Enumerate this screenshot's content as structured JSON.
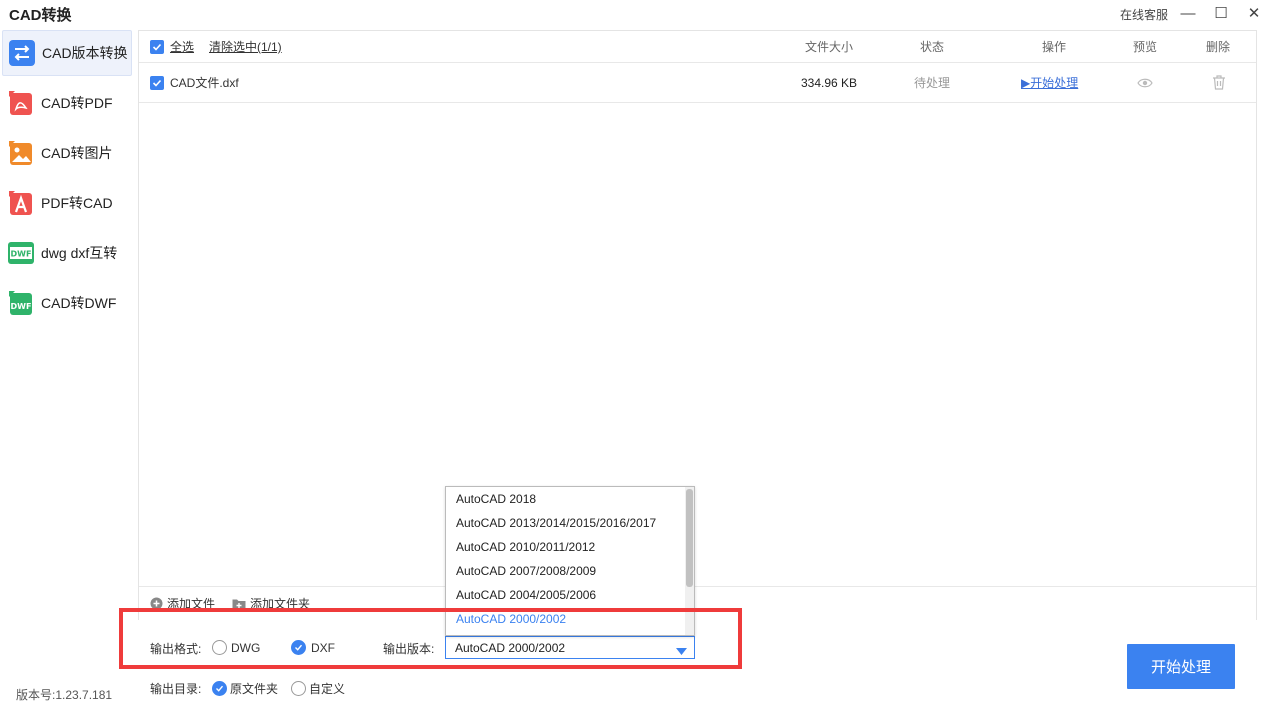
{
  "app": {
    "title": "CAD转换",
    "online_service": "在线客服",
    "version": "版本号:1.23.7.181"
  },
  "window_controls": {
    "minimize_glyph": "—",
    "maximize_glyph": "☐",
    "close_glyph": "✕"
  },
  "sidebar": {
    "items": [
      {
        "label": "CAD版本转换",
        "icon": "convert-arrows-icon",
        "active": true
      },
      {
        "label": "CAD转PDF",
        "icon": "pdf-icon"
      },
      {
        "label": "CAD转图片",
        "icon": "image-icon"
      },
      {
        "label": "PDF转CAD",
        "icon": "pdf-to-cad-icon"
      },
      {
        "label": "dwg dxf互转",
        "icon": "dwf-swap-icon"
      },
      {
        "label": "CAD转DWF",
        "icon": "dwf-icon"
      }
    ]
  },
  "table": {
    "select_all": "全选",
    "clear_selected": "清除选中(1/1)",
    "columns": {
      "size": "文件大小",
      "status": "状态",
      "action": "操作",
      "preview": "预览",
      "delete": "删除"
    },
    "rows": [
      {
        "name": "CAD文件.dxf",
        "size": "334.96 KB",
        "status": "待处理",
        "action": "▶开始处理",
        "checked": true
      }
    ]
  },
  "footer": {
    "add_file": "添加文件",
    "add_folder": "添加文件夹"
  },
  "options": {
    "format_label": "输出格式:",
    "formats": [
      {
        "label": "DWG",
        "selected": false
      },
      {
        "label": "DXF",
        "selected": true
      }
    ],
    "version_label": "输出版本:",
    "version_value": "AutoCAD 2000/2002",
    "version_options": [
      "AutoCAD 2018",
      "AutoCAD 2013/2014/2015/2016/2017",
      "AutoCAD 2010/2011/2012",
      "AutoCAD 2007/2008/2009",
      "AutoCAD 2004/2005/2006",
      "AutoCAD 2000/2002"
    ],
    "dir_label": "输出目录:",
    "dirs": [
      {
        "label": "原文件夹",
        "selected": true
      },
      {
        "label": "自定义",
        "selected": false
      }
    ]
  },
  "start_button": "开始处理",
  "colors": {
    "accent": "#3b82f0",
    "highlight": "#ef3b3b"
  }
}
